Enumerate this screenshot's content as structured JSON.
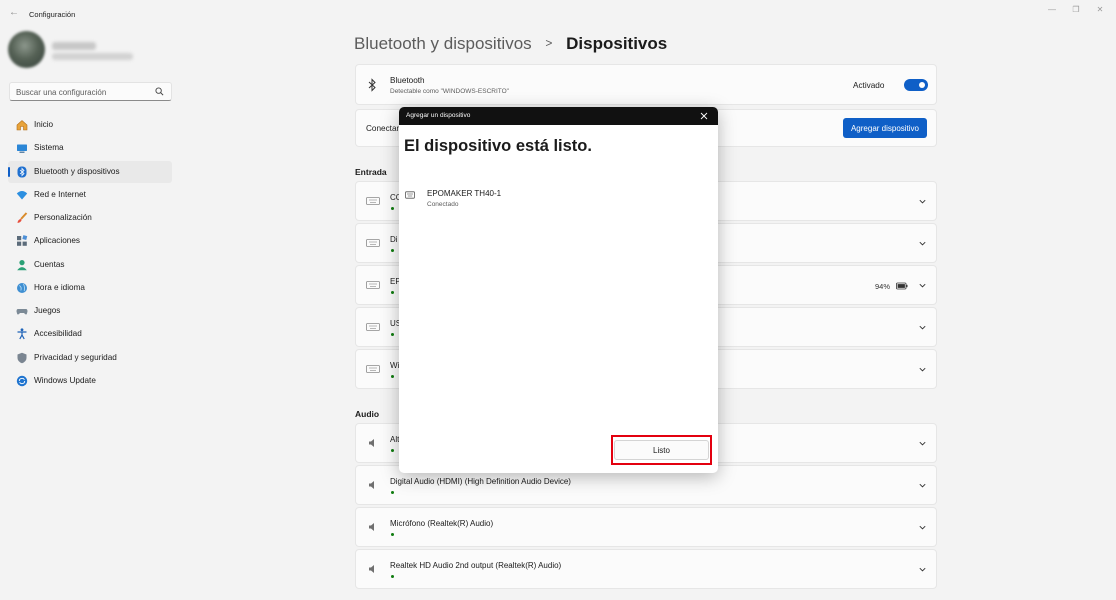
{
  "window": {
    "title": "Configuración"
  },
  "search": {
    "placeholder": "Buscar una configuración"
  },
  "nav": {
    "items": [
      {
        "label": "Inicio",
        "icon": "home-icon"
      },
      {
        "label": "Sistema",
        "icon": "system-icon"
      },
      {
        "label": "Bluetooth y dispositivos",
        "icon": "bluetooth-icon",
        "active": true
      },
      {
        "label": "Red e Internet",
        "icon": "wifi-icon"
      },
      {
        "label": "Personalización",
        "icon": "brush-icon"
      },
      {
        "label": "Aplicaciones",
        "icon": "apps-icon"
      },
      {
        "label": "Cuentas",
        "icon": "account-icon"
      },
      {
        "label": "Hora e idioma",
        "icon": "globe-icon"
      },
      {
        "label": "Juegos",
        "icon": "gamepad-icon"
      },
      {
        "label": "Accesibilidad",
        "icon": "accessibility-icon"
      },
      {
        "label": "Privacidad y seguridad",
        "icon": "shield-icon"
      },
      {
        "label": "Windows Update",
        "icon": "update-icon"
      }
    ]
  },
  "breadcrumb": {
    "parent": "Bluetooth y dispositivos",
    "separator": ">",
    "current": "Dispositivos"
  },
  "bluetooth": {
    "title": "Bluetooth",
    "subtitle": "Detectable como \"WINDOWS-ESCRITO\"",
    "state": "Activado",
    "on": true
  },
  "connect": {
    "label": "Conectar",
    "add_button": "Agregar dispositivo"
  },
  "sections": {
    "input": "Entrada",
    "audio": "Audio"
  },
  "input_devices": [
    {
      "name": "CO",
      "icon": "keyboard-icon"
    },
    {
      "name": "Di",
      "icon": "keyboard-icon"
    },
    {
      "name": "EP",
      "icon": "keyboard-icon",
      "battery": "94%"
    },
    {
      "name": "US",
      "icon": "keyboard-icon"
    },
    {
      "name": "Wi",
      "icon": "keyboard-icon"
    }
  ],
  "audio_devices": [
    {
      "name": "Alt",
      "icon": "speaker-icon"
    },
    {
      "name": "Digital Audio (HDMI) (High Definition Audio Device)",
      "icon": "speaker-icon"
    },
    {
      "name": "Micrófono (Realtek(R) Audio)",
      "icon": "speaker-icon"
    },
    {
      "name": "Realtek HD Audio 2nd output (Realtek(R) Audio)",
      "icon": "speaker-icon"
    }
  ],
  "dialog": {
    "title": "Agregar un dispositivo",
    "heading": "El dispositivo está listo.",
    "device_name": "EPOMAKER TH40-1",
    "device_status": "Conectado",
    "done_button": "Listo"
  },
  "colors": {
    "accent": "#0f5fc7",
    "highlight": "#e3000f",
    "status_ok": "#107c10"
  }
}
